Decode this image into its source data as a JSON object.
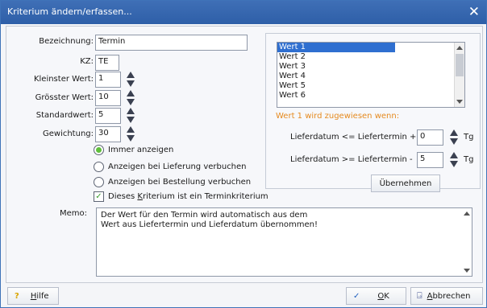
{
  "window": {
    "title": "Kriterium ändern/erfassen..."
  },
  "form": {
    "bezeichnung_label": "Bezeichnung:",
    "bezeichnung_value": "Termin",
    "kz_label": "KZ:",
    "kz_value": "TE",
    "kleinster_label": "Kleinster Wert:",
    "kleinster_value": "1",
    "groesster_label": "Grösster Wert:",
    "groesster_value": "10",
    "standard_label": "Standardwert:",
    "standard_value": "5",
    "gewichtung_label": "Gewichtung:",
    "gewichtung_value": "30",
    "options": {
      "immer": "Immer anzeigen",
      "lieferung": "Anzeigen bei Lieferung verbuchen",
      "bestellung": "Anzeigen bei Bestellung verbuchen",
      "checkbox_pre": "Dieses ",
      "checkbox_ul": "K",
      "checkbox_post": "riterium ist ein Terminkriterium"
    },
    "memo_label": "Memo:",
    "memo_line1": "Der Wert für den Termin wird automatisch aus dem",
    "memo_line2": "Wert aus Liefertermin und Lieferdatum übernommen!"
  },
  "werte": {
    "items": [
      "Wert 1",
      "Wert 2",
      "Wert 3",
      "Wert 4",
      "Wert 5",
      "Wert 6"
    ],
    "selected": "Wert 1",
    "assign_text": "Wert 1 wird zugewiesen wenn:",
    "row1_label": "Lieferdatum <= Liefertermin +",
    "row1_value": "0",
    "row2_label": "Lieferdatum >= Liefertermin -",
    "row2_value": "5",
    "unit": "Tg",
    "apply_button": "Übernehmen"
  },
  "buttons": {
    "help_pre": "",
    "help_ul": "H",
    "help_post": "ilfe",
    "ok_ul": "O",
    "ok_post": "K",
    "cancel_ul": "A",
    "cancel_post": "bbrechen"
  },
  "colors": {
    "titlebar": "#2e5fa8",
    "accent_orange": "#e58a1f",
    "selection": "#2f6fd0",
    "check_green": "#3a9c2c"
  }
}
